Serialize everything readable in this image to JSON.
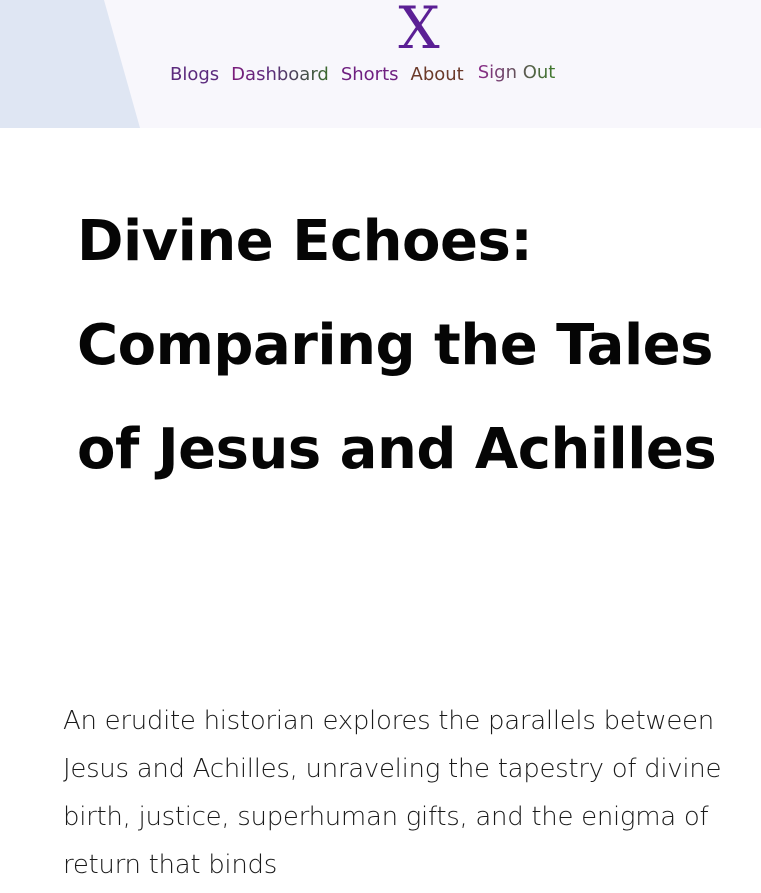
{
  "header": {
    "logo_text": "X",
    "nav": {
      "blogs": "Blogs",
      "dashboard": "Dashboard",
      "shorts": "Shorts",
      "about": "About",
      "sign_out": "Sign Out"
    }
  },
  "article": {
    "title": "Divine Echoes: Comparing the Tales of Jesus and Achilles",
    "intro": "An erudite historian explores the parallels between Jesus and Achilles, unraveling the tapestry of divine birth, justice, superhuman gifts, and the enigma of return that binds"
  },
  "colors": {
    "header_bg": "#f8f7fc",
    "header_accent": "#dfe6f3",
    "logo": "#5b1f95",
    "title": "#050505"
  }
}
